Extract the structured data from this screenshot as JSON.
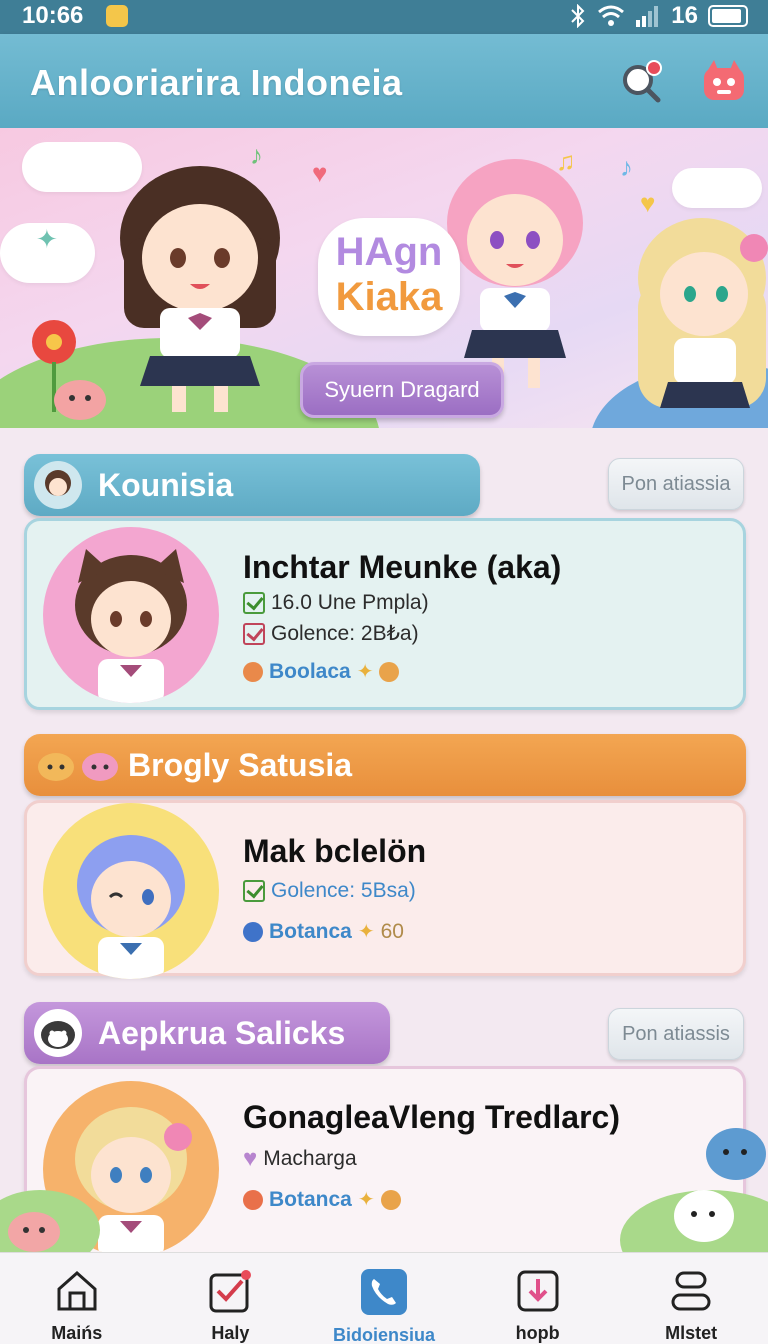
{
  "status_bar": {
    "time": "10:66",
    "signal_text": "16",
    "battery_level": 0.9
  },
  "header": {
    "title": "Anlooriarira Indoneia",
    "icons": [
      "search-icon",
      "mascot-icon"
    ]
  },
  "banner": {
    "logo_line_1": "HAgn",
    "logo_line_2": "Kiaka",
    "cta_label": "Syuern Dragard"
  },
  "sections": [
    {
      "title": "Kounisia",
      "action_label": "Pon atiassia",
      "color": "#66b3cf",
      "card": {
        "title": "Inchtar Meunke (aka)",
        "meta": [
          {
            "icon": "check-icon",
            "text": "16.0 Une Pmpla)"
          },
          {
            "icon": "check-icon",
            "text": "Golence: 2B₺a)"
          }
        ],
        "link_text": "Boolaca"
      }
    },
    {
      "title": "Brogly Satusia",
      "action_label": "",
      "color": "#ee9a45",
      "card": {
        "title": "Mak bclelön",
        "meta": [
          {
            "icon": "check-icon",
            "text": "Golence: 5Bsa)"
          }
        ],
        "link_text": "Botanca",
        "link_suffix": "60"
      }
    },
    {
      "title": "Aepkrua Salicks",
      "action_label": "Pon atiassis",
      "color": "#b784cf",
      "card": {
        "title": "GonagleaVleng Tredlarc)",
        "meta": [
          {
            "icon": "heart-icon",
            "text": "Machargа"
          }
        ],
        "link_text": "Botanca"
      }
    }
  ],
  "bottom_nav": [
    {
      "label": "Maińs",
      "icon": "home-icon",
      "active": false
    },
    {
      "label": "Haly",
      "icon": "checklist-icon",
      "active": false
    },
    {
      "label": "Bidoiensiua",
      "icon": "phone-icon",
      "active": true
    },
    {
      "label": "hopb",
      "icon": "download-icon",
      "active": false
    },
    {
      "label": "Mlstet",
      "icon": "stack-icon",
      "active": false
    }
  ],
  "colors": {
    "primary": "#5aa9c3",
    "status_bar": "#3f7e96",
    "accent_orange": "#ee9a45",
    "accent_purple": "#b784cf"
  }
}
